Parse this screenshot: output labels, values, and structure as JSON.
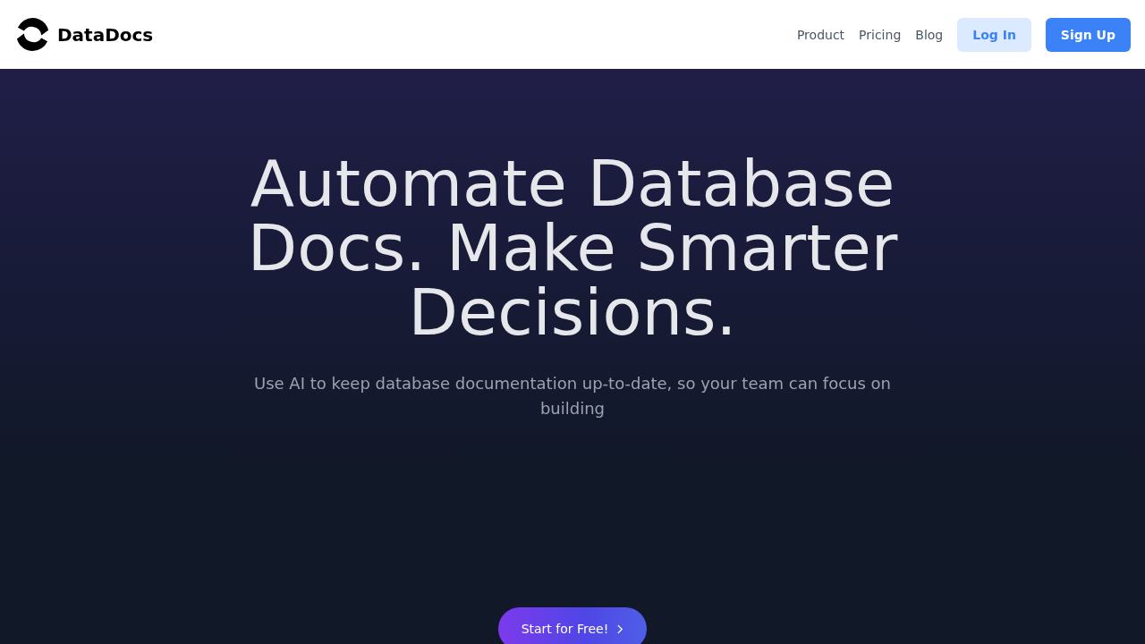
{
  "header": {
    "brand": "DataDocs",
    "nav": [
      "Product",
      "Pricing",
      "Blog"
    ],
    "login": "Log In",
    "signup": "Sign Up"
  },
  "hero": {
    "title": "Automate Database Docs. Make Smarter Decisions.",
    "subtitle": "Use AI to keep database documentation up-to-date, so your team can focus on building",
    "cta": "Start for Free!"
  }
}
